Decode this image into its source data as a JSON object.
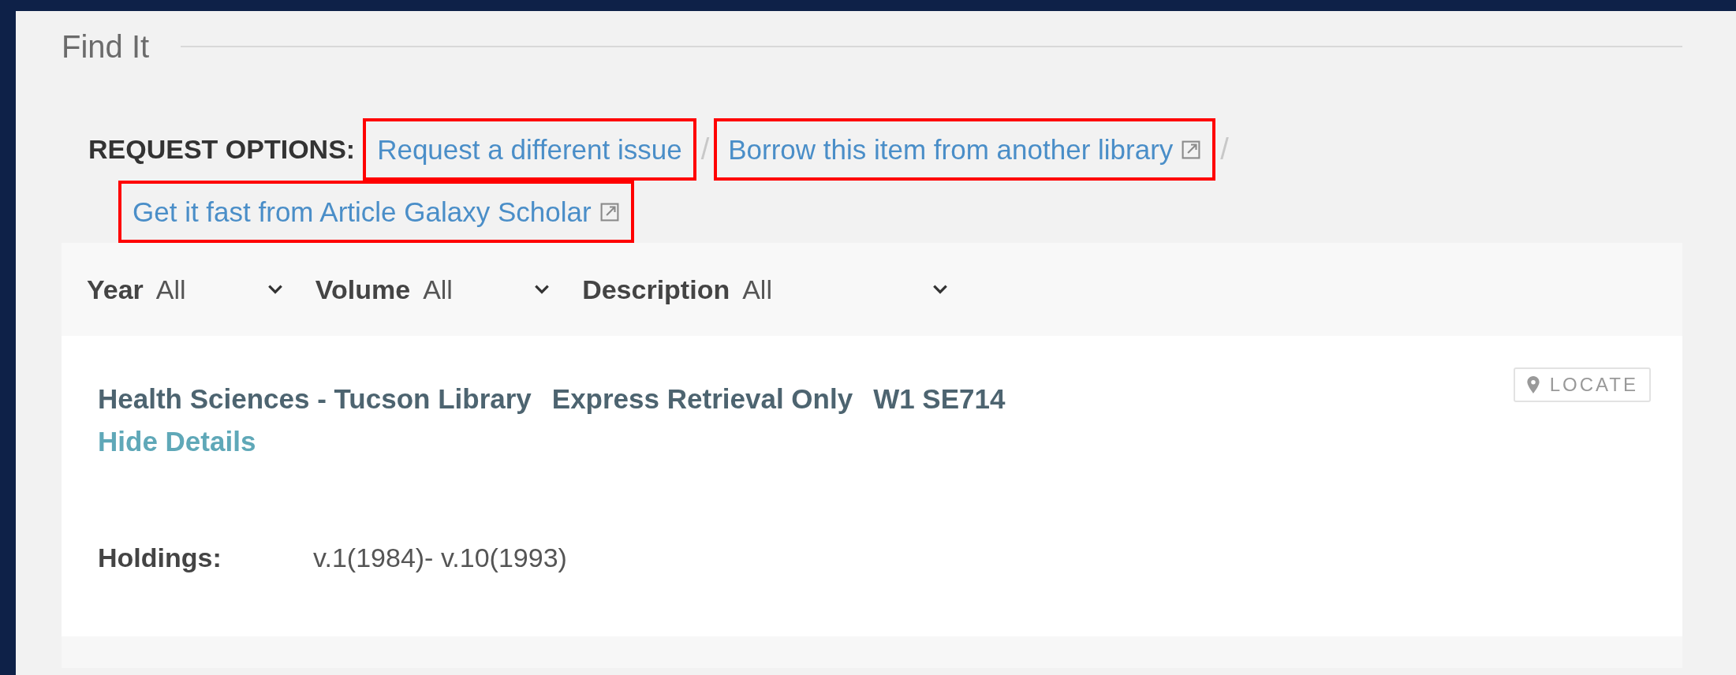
{
  "section": {
    "title": "Find It"
  },
  "request_options": {
    "label": "REQUEST OPTIONS:",
    "links": [
      {
        "text": "Request a different issue",
        "external": false,
        "highlighted": true,
        "separator": "/"
      },
      {
        "text": "Borrow this item from another library",
        "external": true,
        "highlighted": true,
        "separator": "/"
      },
      {
        "text": "Get it fast from Article Galaxy Scholar",
        "external": true,
        "highlighted": true
      }
    ]
  },
  "filters": [
    {
      "label": "Year",
      "value": "All"
    },
    {
      "label": "Volume",
      "value": "All"
    },
    {
      "label": "Description",
      "value": "All"
    }
  ],
  "location": {
    "library": "Health Sciences - Tucson Library",
    "collection": "Express Retrieval Only",
    "call_number": "W1 SE714",
    "details_link": "Hide Details",
    "locate_button": "LOCATE",
    "holdings_label": "Holdings:",
    "holdings_value": "v.1(1984)- v.10(1993)"
  }
}
